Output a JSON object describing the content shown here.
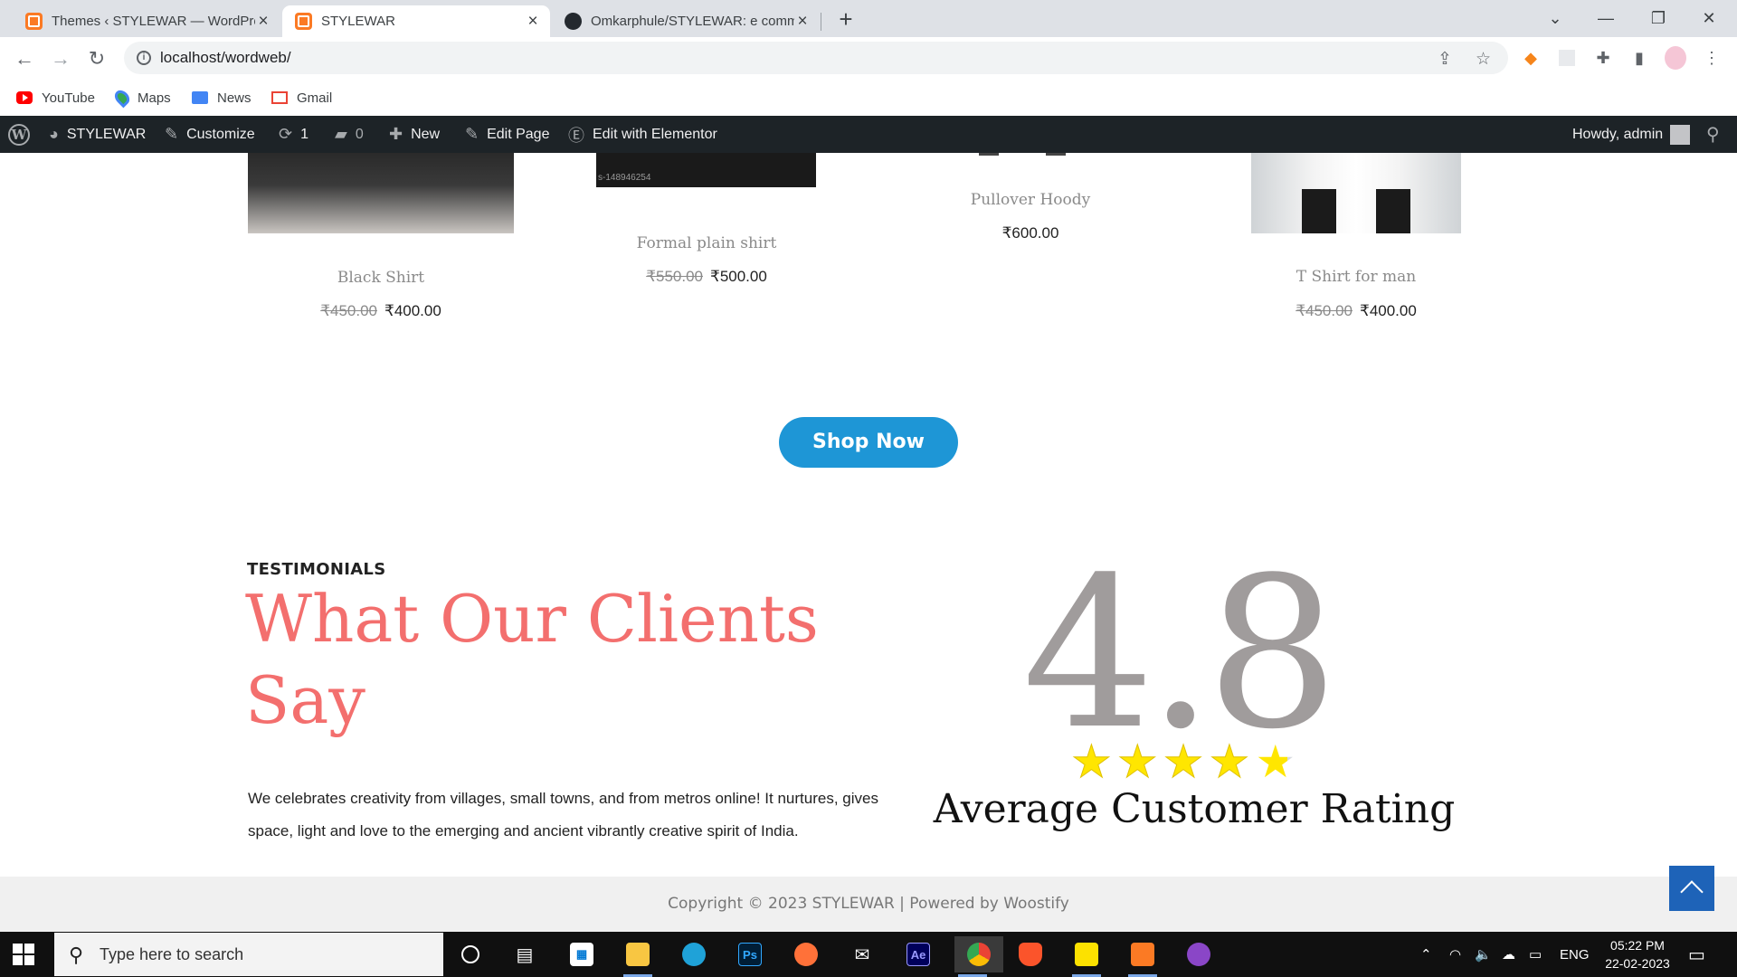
{
  "browser": {
    "tabs": [
      {
        "title": "Themes ‹ STYLEWAR — WordPress",
        "active": false
      },
      {
        "title": "STYLEWAR",
        "active": true
      },
      {
        "title": "Omkarphule/STYLEWAR: e commerce",
        "active": false
      }
    ],
    "url": "localhost/wordweb/",
    "bookmarks": [
      "YouTube",
      "Maps",
      "News",
      "Gmail"
    ]
  },
  "adminbar": {
    "site_name": "STYLEWAR",
    "customize": "Customize",
    "updates_count": "1",
    "comments_count": "0",
    "new_label": "New",
    "edit_page": "Edit Page",
    "elementor": "Edit with Elementor",
    "howdy": "Howdy, admin"
  },
  "products": [
    {
      "name": "Black Shirt",
      "old_price": "₹450.00",
      "price": "₹400.00"
    },
    {
      "name": "Formal plain shirt",
      "old_price": "₹550.00",
      "price": "₹500.00",
      "image_caption": "s-148946254"
    },
    {
      "name": "Pullover Hoody",
      "old_price": "",
      "price": "₹600.00"
    },
    {
      "name": "T Shirt for man",
      "old_price": "₹450.00",
      "price": "₹400.00"
    }
  ],
  "shop_button": "Shop Now",
  "testimonials": {
    "label": "TESTIMONIALS",
    "title": "What Our Clients Say",
    "description": "We celebrates creativity from villages, small towns, and from metros online! It nurtures, gives space, light and love to the emerging and ancient vibrantly creative spirit of India.",
    "rating": "4.8",
    "rating_value": 4.8,
    "rating_max": 5,
    "rating_caption": "Average Customer Rating"
  },
  "footer": {
    "copyright": "Copyright © 2023 STYLEWAR | Powered by Woostify"
  },
  "taskbar": {
    "search_placeholder": "Type here to search",
    "language": "ENG",
    "time": "05:22 PM",
    "date": "22-02-2023"
  },
  "colors": {
    "accent_blue": "#1e96d6",
    "testimonial_title": "#f36f6e",
    "admin_bar": "#1d2327",
    "rating_number": "#a09c9c"
  }
}
